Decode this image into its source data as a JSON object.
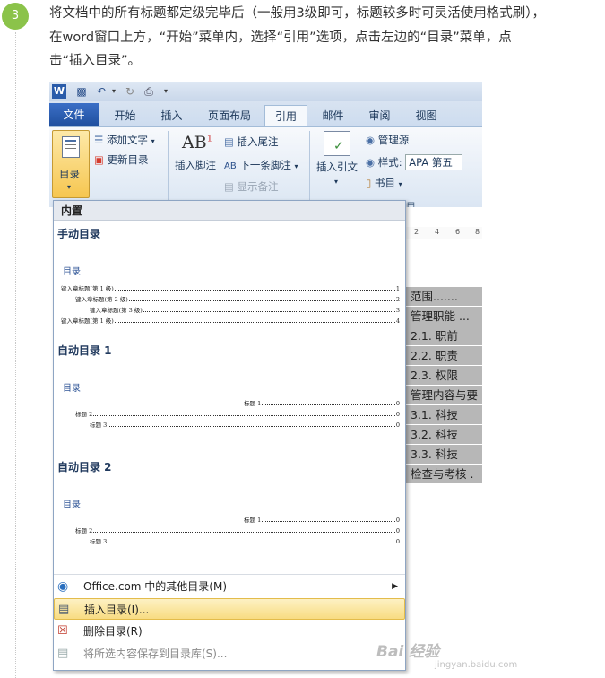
{
  "step": {
    "number": "3"
  },
  "paragraph": {
    "lines": [
      "将文档中的所有标题都定级完毕后（一般用3级即可，标题较多时可灵活使用格式刷），",
      "在word窗口上方，“开始”菜单内，选择“引用”选项，点击左边的“目录”菜单，点",
      "击“插入目录”。"
    ]
  },
  "qat": {
    "word_logo": "W"
  },
  "tabs": [
    "文件",
    "开始",
    "插入",
    "页面布局",
    "引用",
    "邮件",
    "审阅",
    "视图"
  ],
  "ribbon": {
    "toc_label": "目录",
    "add_text": "添加文字",
    "update_toc": "更新目录",
    "insert_footnote": "插入脚注",
    "insert_endnote": "插入尾注",
    "next_footnote": "下一条脚注",
    "show_notes": "显示备注",
    "insert_citation": "插入引文",
    "manage_sources": "管理源",
    "style_label": "样式:",
    "style_value": "APA 第五",
    "bibliography": "书目",
    "group_bibliography_tail": "目"
  },
  "ruler": {
    "ticks": [
      "2",
      "4",
      "6",
      "8"
    ]
  },
  "document_rows": [
    "范围.......",
    "管理职能 ...",
    "2.1.    职前",
    "2.2.    职责",
    "2.3.    权限",
    "管理内容与要",
    "3.1.    科技",
    "3.2.    科技",
    "3.3.    科技",
    "检查与考核 ."
  ],
  "gallery": {
    "header": "内置",
    "manual": {
      "title": "手动目录",
      "preview_title": "目录",
      "lines": [
        {
          "label": "键入章标题(第 1 级)",
          "page": "1"
        },
        {
          "label": "键入章标题(第 2 级)",
          "page": "2"
        },
        {
          "label": "键入章标题(第 3 级)",
          "page": "3"
        },
        {
          "label": "键入章标题(第 1 级)",
          "page": "4"
        }
      ]
    },
    "auto1": {
      "title": "自动目录 1",
      "preview_title": "目录",
      "lines": [
        {
          "label": "标题 1",
          "page": "0"
        },
        {
          "label": "标题 2",
          "page": "0"
        },
        {
          "label": "标题 3",
          "page": "0"
        }
      ]
    },
    "auto2": {
      "title": "自动目录 2",
      "preview_title": "目录",
      "lines": [
        {
          "label": "标题 1",
          "page": "0"
        },
        {
          "label": "标题 2",
          "page": "0"
        },
        {
          "label": "标题 3",
          "page": "0"
        }
      ]
    }
  },
  "menu": {
    "more_toc": "Office.com 中的其他目录(M)",
    "insert_toc": "插入目录(I)...",
    "remove_toc": "删除目录(R)",
    "save_selection": "将所选内容保存到目录库(S)..."
  },
  "watermark": {
    "brand": "Bai 经验",
    "url": "jingyan.baidu.com"
  },
  "colors": {
    "step_badge": "#8bc34a",
    "file_tab": "#2a5caa",
    "highlight": "#f8dc82"
  }
}
